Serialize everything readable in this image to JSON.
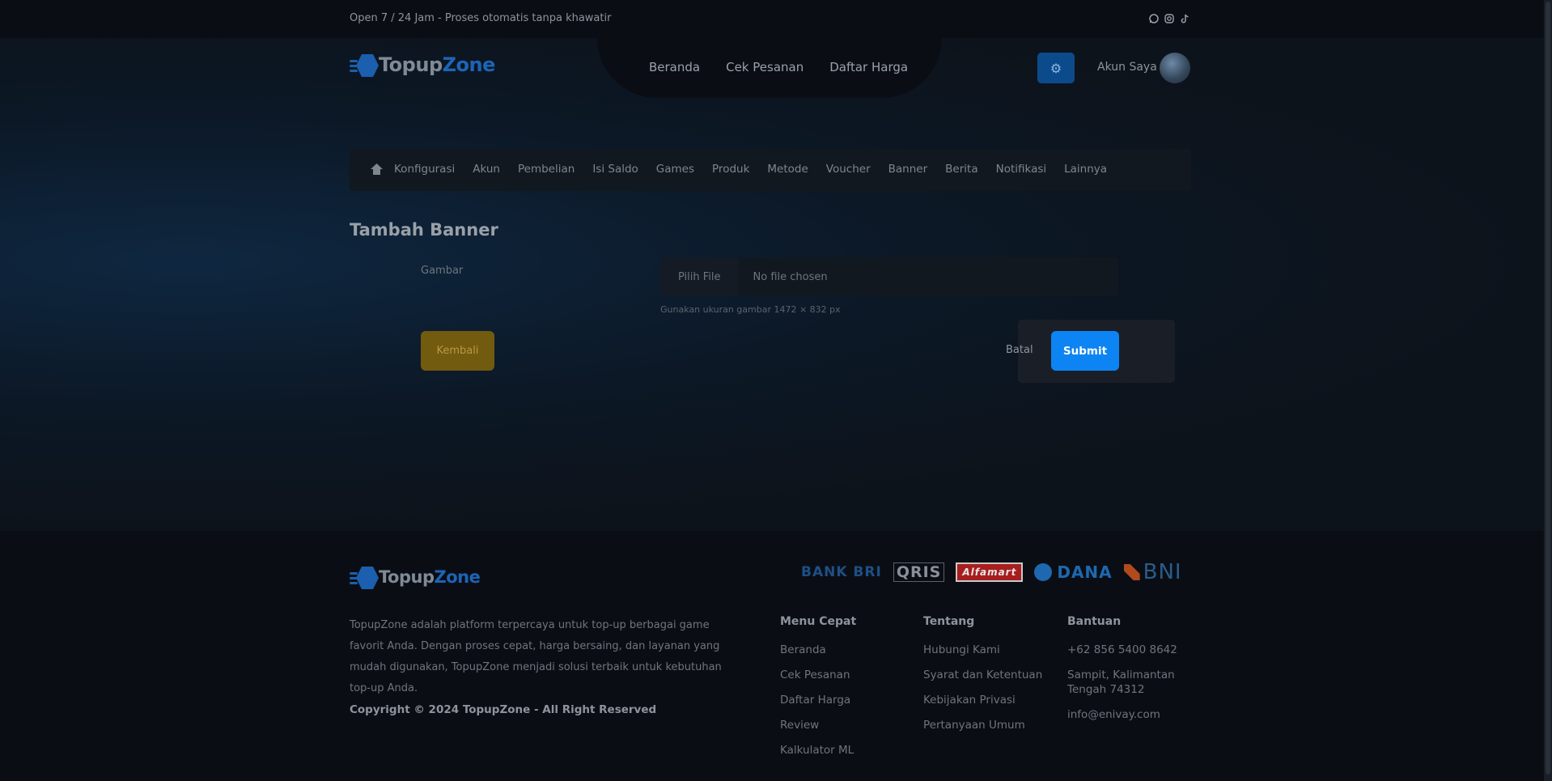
{
  "topbar": {
    "info": "Open 7 / 24 Jam - Proses otomatis tanpa khawatir",
    "social_icons": [
      "whatsapp-icon",
      "instagram-icon",
      "tiktok-icon"
    ]
  },
  "header": {
    "logo_part1": "Topup",
    "logo_part2": "Zone",
    "menu": [
      "Beranda",
      "Cek Pesanan",
      "Daftar Harga"
    ],
    "account_label": "Akun Saya"
  },
  "admin_nav": {
    "items": [
      "Konfigurasi",
      "Akun",
      "Pembelian",
      "Isi Saldo",
      "Games",
      "Produk",
      "Metode",
      "Voucher",
      "Banner",
      "Berita",
      "Notifikasi",
      "Lainnya"
    ]
  },
  "form": {
    "title": "Tambah Banner",
    "image_label": "Gambar",
    "file_button": "Pilih File",
    "file_status": "No file chosen",
    "hint": "Gunakan ukuran gambar 1472 × 832 px",
    "back_label": "Kembali",
    "cancel_label": "Batal",
    "submit_label": "Submit"
  },
  "footer": {
    "logo_part1": "Topup",
    "logo_part2": "Zone",
    "description": "TopupZone adalah platform terpercaya untuk top-up berbagai game favorit Anda. Dengan proses cepat, harga bersaing, dan layanan yang mudah digunakan, TopupZone menjadi solusi terbaik untuk kebutuhan top-up Anda.",
    "copyright": "Copyright © 2024 TopupZone - All Right Reserved",
    "payments": [
      "BANK BRI",
      "QRIS",
      "Alfamart",
      "DANA",
      "BNI"
    ],
    "menu_cepat": {
      "title": "Menu Cepat",
      "links": [
        "Beranda",
        "Cek Pesanan",
        "Daftar Harga",
        "Review",
        "Kalkulator ML"
      ]
    },
    "tentang": {
      "title": "Tentang",
      "links": [
        "Hubungi Kami",
        "Syarat dan Ketentuan",
        "Kebijakan Privasi",
        "Pertanyaan Umum"
      ]
    },
    "bantuan": {
      "title": "Bantuan",
      "phone": "+62 856 5400 8642",
      "address": "Sampit, Kalimantan Tengah 74312",
      "email": "info@enivay.com"
    }
  },
  "colors": {
    "accent_blue": "#0d84f3",
    "back_button": "#725a0f",
    "background": "#0d131b"
  }
}
